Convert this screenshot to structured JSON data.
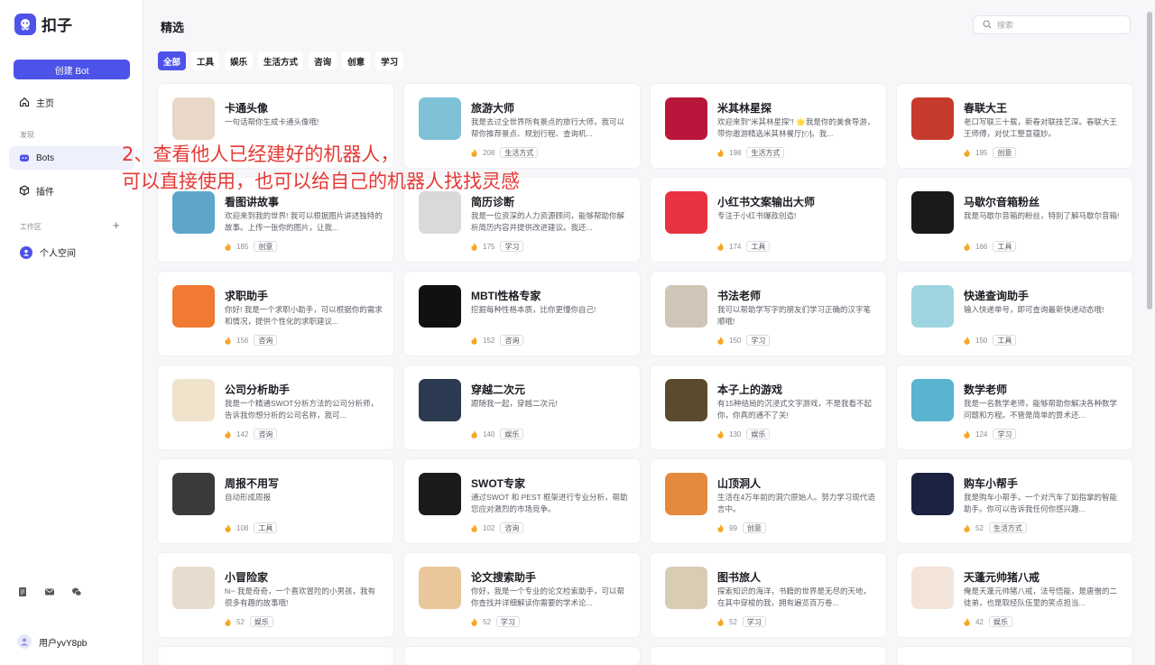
{
  "app": {
    "name": "扣子"
  },
  "sidebar": {
    "create_label": "创建 Bot",
    "home_label": "主页",
    "section_discover": "发现",
    "bots_label": "Bots",
    "plugins_label": "插件",
    "section_workspace": "工作区",
    "personal_space": "个人空间",
    "username": "用户yvY8pb"
  },
  "main": {
    "title": "精选",
    "search_placeholder": "搜索",
    "tabs": [
      "全部",
      "工具",
      "娱乐",
      "生活方式",
      "咨询",
      "创意",
      "学习"
    ]
  },
  "overlay": {
    "line1": "2、查看他人已经建好的机器人，",
    "line2": "可以直接使用，也可以给自己的机器人找找灵感"
  },
  "cards": [
    {
      "title": "卡通头像",
      "desc": "一句话帮你生成卡通头像哦!",
      "count": "",
      "tag": "",
      "avatar_icon": "cartoon-girl-avatar",
      "color": "#e9d7c7"
    },
    {
      "title": "旅游大师",
      "desc": "我是去过全世界所有景点的旅行大师，我可以帮你推荐景点、规划行程、查询机...",
      "count": "208",
      "tag": "生活方式",
      "avatar_icon": "traveler-avatar",
      "color": "#7fc2d8"
    },
    {
      "title": "米其林星探",
      "desc": "欢迎来到\"米其林星探\"! 🌟我是你的美食导游，带你邀游精选米其林餐厅🍽。我...",
      "count": "198",
      "tag": "生活方式",
      "avatar_icon": "michelin-flower-icon",
      "color": "#b8163a"
    },
    {
      "title": "春联大王",
      "desc": "老口写联三十载，新春对联技艺深。春联大王王师傅，对仗工整意蕴妙。",
      "count": "195",
      "tag": "创意",
      "avatar_icon": "old-man-avatar",
      "color": "#c73a2e"
    },
    {
      "title": "看图讲故事",
      "desc": "欢迎来到我的世界! 我可以根据图片讲述独特的故事。上传一张你的图片，让我...",
      "count": "185",
      "tag": "创意",
      "avatar_icon": "story-book-icon",
      "color": "#5da6c9"
    },
    {
      "title": "简历诊断",
      "desc": "我是一位资深的人力资源顾问，能够帮助你解析简历内容并提供改进建议。我还...",
      "count": "175",
      "tag": "学习",
      "avatar_icon": "businessman-avatar",
      "color": "#d9d9d9"
    },
    {
      "title": "小红书文案输出大师",
      "desc": "专注于小红书爆款创造!",
      "count": "174",
      "tag": "工具",
      "avatar_icon": "red-book-icon",
      "color": "#e8323f"
    },
    {
      "title": "马歇尔音箱粉丝",
      "desc": "我是马歇尔音箱的粉丝，特别了解马歇尔音箱!",
      "count": "166",
      "tag": "工具",
      "avatar_icon": "speaker-icon",
      "color": "#1a1a1a"
    },
    {
      "title": "求职助手",
      "desc": "你好! 我是一个求职小助手，可以根据你的需求和情况，提供个性化的求职建议...",
      "count": "156",
      "tag": "咨询",
      "avatar_icon": "job-man-avatar",
      "color": "#f07a32"
    },
    {
      "title": "MBTI性格专家",
      "desc": "挖掘每种性格本质，比你更懂你自己!",
      "count": "152",
      "tag": "咨询",
      "avatar_icon": "mbti-logo",
      "color": "#111111"
    },
    {
      "title": "书法老师",
      "desc": "我可以帮助学写字的朋友们学习正确的汉字笔顺哦!",
      "count": "150",
      "tag": "学习",
      "avatar_icon": "calligrapher-avatar",
      "color": "#cfc6b8"
    },
    {
      "title": "快递查询助手",
      "desc": "输入快递单号，即可查询最新快递动态哦!",
      "count": "150",
      "tag": "工具",
      "avatar_icon": "delivery-van-icon",
      "color": "#9fd5e0"
    },
    {
      "title": "公司分析助手",
      "desc": "我是一个精通SWOT分析方法的公司分析师，告诉我你想分析的公司名称，我可...",
      "count": "142",
      "tag": "咨询",
      "avatar_icon": "pie-chart-icon",
      "color": "#efe3cc"
    },
    {
      "title": "穿越二次元",
      "desc": "跟随我一起，穿越二次元!",
      "count": "140",
      "tag": "娱乐",
      "avatar_icon": "anime-avatar",
      "color": "#2d3b52"
    },
    {
      "title": "本子上的游戏",
      "desc": "有15种结局的沉浸式文字游戏，不是我看不起你，你真的通不了关!",
      "count": "130",
      "tag": "娱乐",
      "avatar_icon": "game-board-icon",
      "color": "#5b4a2e"
    },
    {
      "title": "数学老师",
      "desc": "我是一名数学老师，能够帮助你解决各种数学问题和方程。不管是简单的算术还...",
      "count": "124",
      "tag": "学习",
      "avatar_icon": "teacher-avatar",
      "color": "#5ab3cf"
    },
    {
      "title": "周报不用写",
      "desc": "自动形成周报",
      "count": "108",
      "tag": "工具",
      "avatar_icon": "report-doc-icon",
      "color": "#3a3a3c"
    },
    {
      "title": "SWOT专家",
      "desc": "通过SWOT 和 PEST 框架进行专业分析，帮助您应对激烈的市场竞争。",
      "count": "102",
      "tag": "咨询",
      "avatar_icon": "swot-icon",
      "color": "#1b1b1b"
    },
    {
      "title": "山顶洞人",
      "desc": "生活在4万年前的洞穴原始人。努力学习现代语言中。",
      "count": "99",
      "tag": "创意",
      "avatar_icon": "caveman-avatar",
      "color": "#e58a3c"
    },
    {
      "title": "购车小帮手",
      "desc": "我是购车小帮手，一个对汽车了如指掌的智能助手。你可以告诉我任何你感兴趣...",
      "count": "52",
      "tag": "生活方式",
      "avatar_icon": "car-icon",
      "color": "#1c2340"
    },
    {
      "title": "小冒险家",
      "desc": "hi~ 我是奇奇，一个喜欢冒险的小男孩，我有很多有趣的故事哦!",
      "count": "52",
      "tag": "娱乐",
      "avatar_icon": "boy-avatar",
      "color": "#e8dcd0"
    },
    {
      "title": "论文搜索助手",
      "desc": "你好，我是一个专业的论文检索助手，可以帮你查找并详细解读你需要的学术论...",
      "count": "52",
      "tag": "学习",
      "avatar_icon": "paper-book-icon",
      "color": "#e9c79a"
    },
    {
      "title": "图书旅人",
      "desc": "探索知识的海洋，书籍的世界是无尽的天地，在其中穿梭的我，拥有遍览百万卷...",
      "count": "52",
      "tag": "学习",
      "avatar_icon": "library-icon",
      "color": "#d8ccb5"
    },
    {
      "title": "天蓬元帅猪八戒",
      "desc": "俺是天蓬元帅猪八戒，法号悟能，是唐僧的二徒弟，也是取经队伍里的笑点担当...",
      "count": "42",
      "tag": "娱乐",
      "avatar_icon": "pig-avatar",
      "color": "#f3e4da"
    }
  ]
}
